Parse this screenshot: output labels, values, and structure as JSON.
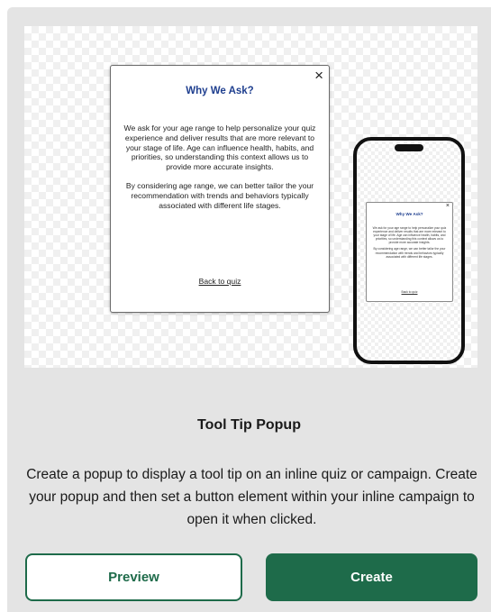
{
  "popup": {
    "title": "Why We Ask?",
    "close_glyph": "×",
    "paragraph1": "We ask for your age range to help personalize your quiz experience and deliver results that are more relevant to your stage of life. Age can influence health, habits, and priorities, so understanding this context allows us to provide more accurate insights.",
    "paragraph2": "By considering age range, we can better tailor the your recommendation with trends and behaviors typically associated with different life stages.",
    "back_link": "Back to quiz"
  },
  "card": {
    "title": "Tool Tip Popup",
    "description": "Create a popup to display a tool tip on an inline quiz or campaign. Create your popup and then set a button element within your inline campaign to open it when clicked.",
    "preview_label": "Preview",
    "create_label": "Create"
  },
  "colors": {
    "accent_green": "#1e6b4a",
    "title_blue": "#1f3f8f",
    "card_background": "#e4e4e4"
  }
}
